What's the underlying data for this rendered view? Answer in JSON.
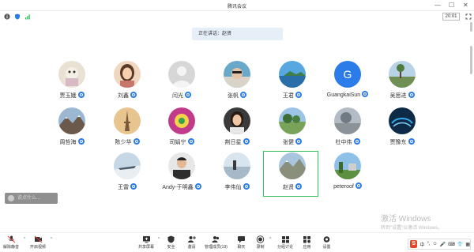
{
  "window": {
    "title": "腾讯会议",
    "timer": "20:01"
  },
  "banner": {
    "speaking_text": "正在讲话：赵贤"
  },
  "participants": [
    {
      "name": "贾玉娥"
    },
    {
      "name": "刘鑫"
    },
    {
      "name": "闫光"
    },
    {
      "name": "张帆"
    },
    {
      "name": "王君"
    },
    {
      "name": "GuangkaiSun",
      "avatar_letter": "G"
    },
    {
      "name": "吴思进"
    },
    {
      "name": "周哲海"
    },
    {
      "name": "陈少华"
    },
    {
      "name": "司娟宁"
    },
    {
      "name": "荆日星"
    },
    {
      "name": "张健"
    },
    {
      "name": "杜中伟"
    },
    {
      "name": "贾豫东"
    },
    {
      "name": "王雷"
    },
    {
      "name": "Andy-于明鑫"
    },
    {
      "name": "李伟仙"
    },
    {
      "name": "赵贤"
    },
    {
      "name": "peteroof"
    }
  ],
  "chat": {
    "placeholder": "说点什么..."
  },
  "toolbar": {
    "mute": "解除静音",
    "video": "开启视频",
    "share": "共享屏幕",
    "security": "安全",
    "invite": "邀请",
    "members": "管理成员(19)",
    "chat": "聊天",
    "record": "录制",
    "breakout": "分组讨论",
    "apps": "应用",
    "settings": "设置"
  },
  "watermark": {
    "line1": "激活 Windows",
    "line2": "转到\"设置\"以激活 Windows。"
  },
  "ime": {
    "logo": "S",
    "lang": "中"
  },
  "colors": {
    "accent": "#2b7ce9",
    "active_border": "#2fbf5f",
    "ime": "#e6452a"
  }
}
